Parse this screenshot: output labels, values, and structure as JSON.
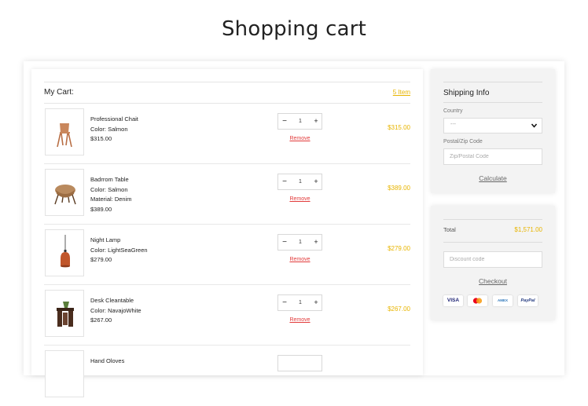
{
  "page": {
    "title": "Shopping cart"
  },
  "cart": {
    "label": "My Cart:",
    "item_count": "5 Item",
    "remove_label": "Remove",
    "items": [
      {
        "name": "Professional Chait",
        "lines": [
          "Color:  Salmon"
        ],
        "price": "$315.00",
        "qty": "1",
        "total": "$315.00",
        "image": "chair-icon"
      },
      {
        "name": "Badrrom Table",
        "lines": [
          "Color:  Salmon",
          "Material:  Denim"
        ],
        "price": "$389.00",
        "qty": "1",
        "total": "$389.00",
        "image": "armchair-icon"
      },
      {
        "name": "Night Lamp",
        "lines": [
          "Color:  LightSeaGreen"
        ],
        "price": "$279.00",
        "qty": "1",
        "total": "$279.00",
        "image": "lamp-icon"
      },
      {
        "name": "Desk Cleantable",
        "lines": [
          "Color:  NavajoWhite"
        ],
        "price": "$267.00",
        "qty": "1",
        "total": "$267.00",
        "image": "desk-icon"
      },
      {
        "name": "Hand Oloves",
        "lines": [],
        "price": "",
        "qty": "",
        "total": "",
        "image": "gloves-icon"
      }
    ]
  },
  "shipping": {
    "title": "Shipping Info",
    "country_label": "Country",
    "country_value": "---",
    "zip_label": "Postal/Zip Code",
    "zip_placeholder": "Zip/Postal Code",
    "calculate_label": "Calculate"
  },
  "summary": {
    "total_label": "Total",
    "total_value": "$1,571.00",
    "discount_placeholder": "Discount code",
    "checkout_label": "Checkout",
    "payments": [
      "VISA",
      "AMEX",
      "PayPal"
    ]
  },
  "colors": {
    "accent": "#e8b500",
    "remove": "#e23b3b",
    "panel_bg": "#f3f3f3"
  }
}
